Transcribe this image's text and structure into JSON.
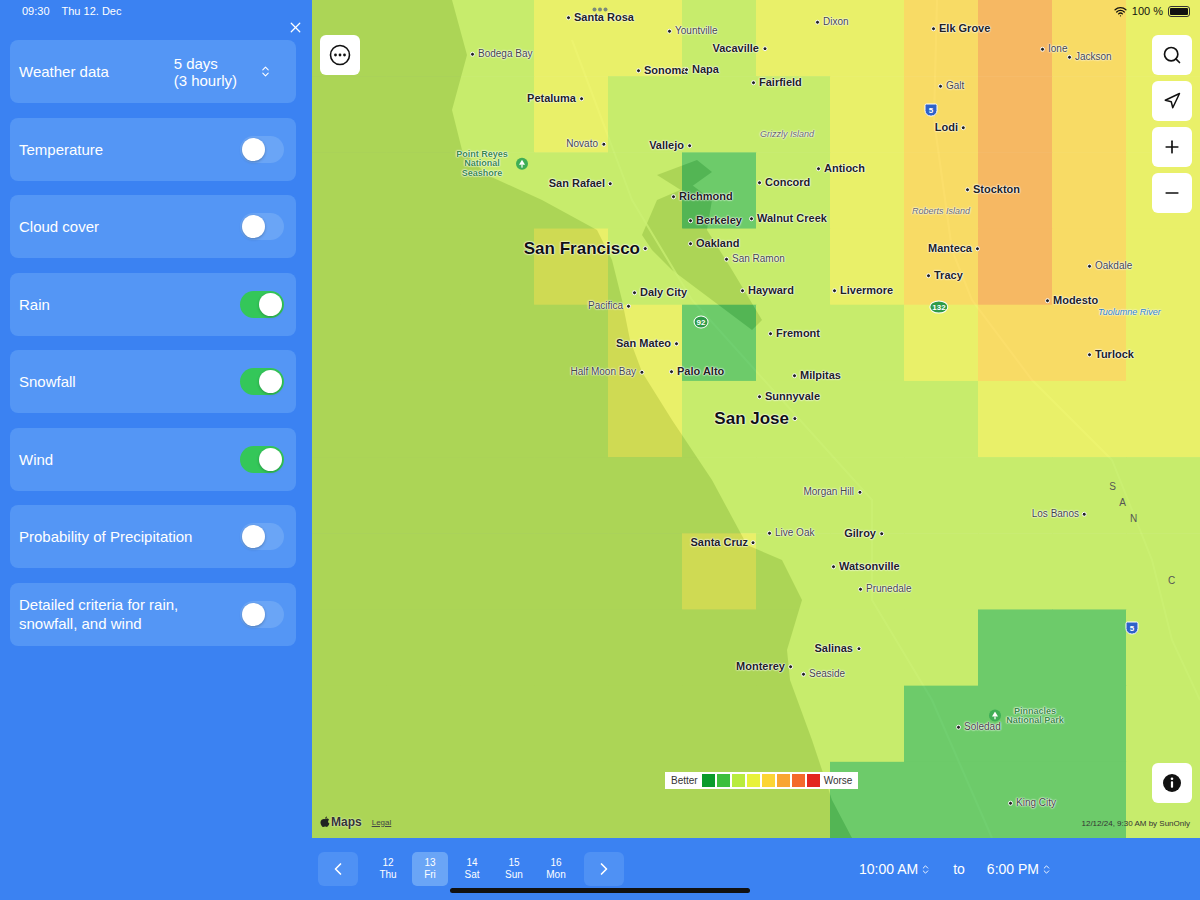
{
  "status_bar": {
    "time": "09:30",
    "date": "Thu 12. Dec",
    "battery": "100 %",
    "battery_level": 1
  },
  "sidebar": {
    "settings": [
      {
        "label": "Weather data",
        "kind": "select",
        "value": [
          "5 days",
          "(3 hourly)"
        ]
      },
      {
        "label": "Temperature",
        "kind": "toggle",
        "on": false
      },
      {
        "label": "Cloud cover",
        "kind": "toggle",
        "on": false
      },
      {
        "label": "Rain",
        "kind": "toggle",
        "on": true
      },
      {
        "label": "Snowfall",
        "kind": "toggle",
        "on": true
      },
      {
        "label": "Wind",
        "kind": "toggle",
        "on": true
      },
      {
        "label": "Probability of Precipitation",
        "kind": "toggle",
        "on": false
      },
      {
        "label": "Detailed criteria for rain, snowfall, and wind",
        "kind": "toggle",
        "on": false
      }
    ]
  },
  "map": {
    "heatmap": [
      [
        2,
        2,
        2,
        3,
        3,
        2,
        3,
        3,
        4,
        5,
        4,
        3
      ],
      [
        2,
        2,
        2,
        3,
        2,
        2,
        2,
        3,
        4,
        5,
        4,
        3
      ],
      [
        2,
        2,
        2,
        2,
        2,
        1,
        2,
        3,
        4,
        5,
        4,
        3
      ],
      [
        2,
        2,
        2,
        3,
        2,
        2,
        2,
        3,
        4,
        5,
        4,
        3
      ],
      [
        2,
        2,
        2,
        2,
        3,
        1,
        2,
        2,
        3,
        4,
        4,
        3
      ],
      [
        2,
        2,
        2,
        2,
        3,
        2,
        2,
        2,
        2,
        3,
        3,
        3
      ],
      [
        2,
        2,
        2,
        2,
        2,
        2,
        2,
        2,
        2,
        2,
        2,
        2
      ],
      [
        2,
        2,
        2,
        2,
        2,
        3,
        2,
        2,
        2,
        2,
        2,
        2
      ],
      [
        2,
        2,
        2,
        2,
        2,
        2,
        2,
        2,
        2,
        1,
        1,
        2
      ],
      [
        2,
        2,
        2,
        2,
        2,
        2,
        2,
        2,
        1,
        1,
        1,
        2
      ],
      [
        2,
        2,
        2,
        2,
        2,
        2,
        2,
        1,
        1,
        1,
        1,
        2
      ]
    ],
    "places": [
      {
        "name": "Santa Rosa",
        "kind": "city"
      },
      {
        "name": "Yountville",
        "kind": "town"
      },
      {
        "name": "Dixon",
        "kind": "town"
      },
      {
        "name": "Elk Grove",
        "kind": "city"
      },
      {
        "name": "Bodega Bay",
        "kind": "town"
      },
      {
        "name": "Vacaville",
        "kind": "city"
      },
      {
        "name": "Ione",
        "kind": "town"
      },
      {
        "name": "Jackson",
        "kind": "town"
      },
      {
        "name": "Sonoma",
        "kind": "city"
      },
      {
        "name": "Napa",
        "kind": "city"
      },
      {
        "name": "Galt",
        "kind": "town"
      },
      {
        "name": "Fairfield",
        "kind": "city"
      },
      {
        "name": "Grizzly Island",
        "kind": "area"
      },
      {
        "name": "Petaluma",
        "kind": "city"
      },
      {
        "name": "Lodi",
        "kind": "city"
      },
      {
        "name": "Novato",
        "kind": "town"
      },
      {
        "name": "Vallejo",
        "kind": "city"
      },
      {
        "name": "Point Reyes National Seashore",
        "kind": "park"
      },
      {
        "name": "Antioch",
        "kind": "city"
      },
      {
        "name": "San Rafael",
        "kind": "city"
      },
      {
        "name": "Concord",
        "kind": "city"
      },
      {
        "name": "Richmond",
        "kind": "city"
      },
      {
        "name": "Stockton",
        "kind": "city"
      },
      {
        "name": "Roberts Island",
        "kind": "area"
      },
      {
        "name": "Berkeley",
        "kind": "city"
      },
      {
        "name": "Walnut Creek",
        "kind": "city"
      },
      {
        "name": "San Francisco",
        "kind": "major"
      },
      {
        "name": "Oakland",
        "kind": "city"
      },
      {
        "name": "San Ramon",
        "kind": "town"
      },
      {
        "name": "Manteca",
        "kind": "city"
      },
      {
        "name": "Tracy",
        "kind": "city"
      },
      {
        "name": "Oakdale",
        "kind": "town"
      },
      {
        "name": "Pacifica",
        "kind": "town"
      },
      {
        "name": "Daly City",
        "kind": "city"
      },
      {
        "name": "Hayward",
        "kind": "city"
      },
      {
        "name": "Livermore",
        "kind": "city"
      },
      {
        "name": "Modesto",
        "kind": "city"
      },
      {
        "name": "Tuolumne River",
        "kind": "river"
      },
      {
        "name": "San Mateo",
        "kind": "city"
      },
      {
        "name": "Fremont",
        "kind": "city"
      },
      {
        "name": "Turlock",
        "kind": "city"
      },
      {
        "name": "Half Moon Bay",
        "kind": "town"
      },
      {
        "name": "Palo Alto",
        "kind": "city"
      },
      {
        "name": "Milpitas",
        "kind": "city"
      },
      {
        "name": "Sunnyvale",
        "kind": "city"
      },
      {
        "name": "San Jose",
        "kind": "major"
      },
      {
        "name": "Morgan Hill",
        "kind": "town"
      },
      {
        "name": "Los Banos",
        "kind": "town"
      },
      {
        "name": "Live Oak",
        "kind": "town"
      },
      {
        "name": "Gilroy",
        "kind": "city"
      },
      {
        "name": "Santa Cruz",
        "kind": "city"
      },
      {
        "name": "Watsonville",
        "kind": "city"
      },
      {
        "name": "Prunedale",
        "kind": "town"
      },
      {
        "name": "Salinas",
        "kind": "city"
      },
      {
        "name": "Monterey",
        "kind": "city"
      },
      {
        "name": "Seaside",
        "kind": "town"
      },
      {
        "name": "Pinnacles National Park",
        "kind": "park"
      },
      {
        "name": "Soledad",
        "kind": "town"
      },
      {
        "name": "King City",
        "kind": "town"
      }
    ],
    "shields": [
      {
        "number": "5",
        "kind": "interstate"
      },
      {
        "number": "132",
        "kind": "state"
      },
      {
        "number": "92",
        "kind": "state"
      },
      {
        "number": "5",
        "kind": "interstate"
      }
    ],
    "range_letters": [
      "S",
      "A",
      "N",
      "C"
    ],
    "legend": {
      "better": "Better",
      "worse": "Worse",
      "colors": [
        "#0a9b2c",
        "#3cbf3c",
        "#b8ec3e",
        "#e8f23a",
        "#fcd535",
        "#f9a532",
        "#f46a2c",
        "#e3261f"
      ]
    },
    "brand": "Maps",
    "legal": "Legal",
    "attribution": "12/12/24, 9:30 AM by SunOnly"
  },
  "date_picker": {
    "days": [
      {
        "day": "12",
        "weekday": "Thu",
        "selected": false
      },
      {
        "day": "13",
        "weekday": "Fri",
        "selected": true
      },
      {
        "day": "14",
        "weekday": "Sat",
        "selected": false
      },
      {
        "day": "15",
        "weekday": "Sun",
        "selected": false
      },
      {
        "day": "16",
        "weekday": "Mon",
        "selected": false
      }
    ]
  },
  "time_range": {
    "from": "10:00 AM",
    "to_label": "to",
    "to": "6:00 PM"
  }
}
